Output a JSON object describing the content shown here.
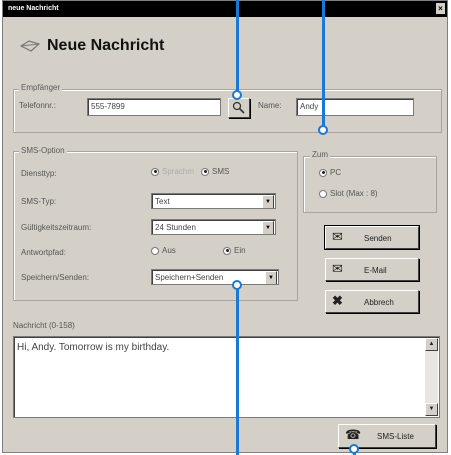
{
  "window": {
    "title": "neue Nachricht",
    "close_glyph": "×"
  },
  "header": {
    "title": "Neue Nachricht",
    "icon": "message-icon"
  },
  "empfaenger": {
    "group_label": "Empfänger",
    "telefon_label": "Telefonnr.:",
    "telefon_value": "555-7899",
    "lookup_button_icon": "magnifier-icon",
    "name_label": "Name:",
    "name_value": "Andy"
  },
  "sms_option": {
    "group_label": "SMS-Option",
    "dienst_label": "Diensttyp:",
    "dienst_options": [
      "Sprachm",
      "SMS"
    ],
    "sms_typ_label": "SMS-Typ:",
    "sms_typ_value": "Text",
    "gueltigkeit_label": "Gültigkeitszeitraum:",
    "gueltigkeit_value": "24 Stunden",
    "antwort_label": "Antwortpfad:",
    "antwort_options": [
      "Aus",
      "Ein"
    ],
    "speichern_label": "Speichern/Senden:",
    "speichern_value": "Speichern+Senden"
  },
  "zum": {
    "group_label": "Zum",
    "options": [
      "PC",
      "Slot (Max : 8)"
    ]
  },
  "buttons": {
    "senden": "Senden",
    "eMail": "E-Mail",
    "abbrechen": "Abbrech",
    "sms_liste": "SMS-Liste"
  },
  "nachricht": {
    "label": "Nachricht (0-158)",
    "text": "Hi, Andy. Tomorrow is my birthday."
  },
  "colors": {
    "callout": "#1a78d6",
    "title_bar": "#000000",
    "window_bg": "#d4d0c8"
  }
}
